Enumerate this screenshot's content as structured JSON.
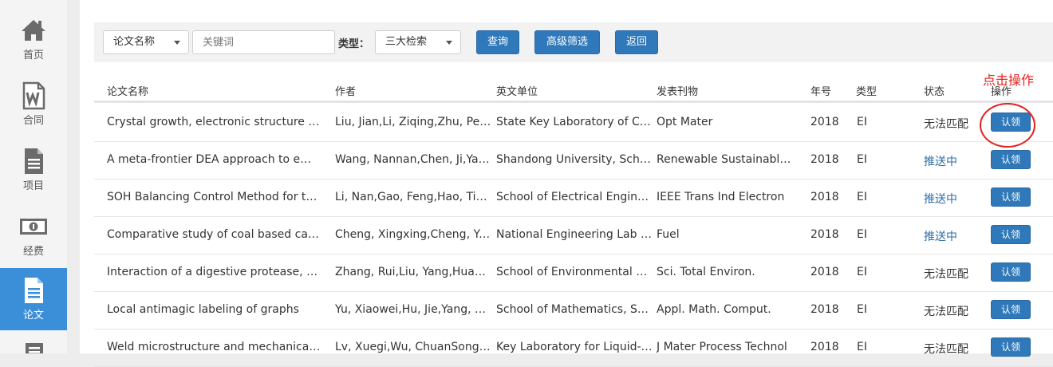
{
  "sidebar": {
    "items": [
      {
        "label": "首页",
        "icon": "home-icon",
        "active": false
      },
      {
        "label": "合同",
        "icon": "word-doc-icon",
        "active": false
      },
      {
        "label": "项目",
        "icon": "document-icon",
        "active": false
      },
      {
        "label": "经费",
        "icon": "money-icon",
        "active": false
      },
      {
        "label": "论文",
        "icon": "paper-icon",
        "active": true
      },
      {
        "label": "",
        "icon": "book-icon",
        "active": false
      }
    ],
    "active_color": "#3b8fd9"
  },
  "filter": {
    "field_select": "论文名称",
    "keyword_placeholder": "关键词",
    "type_label": "类型：",
    "type_select": "三大检索",
    "query_button": "查询",
    "advanced_button": "高级筛选",
    "back_button": "返回"
  },
  "table": {
    "headers": {
      "title": "论文名称",
      "author": "作者",
      "unit": "英文单位",
      "journal": "发表刊物",
      "year": "年号",
      "type": "类型",
      "status": "状态",
      "action": "操作"
    },
    "rows": [
      {
        "title": "Crystal growth, electronic structure an...",
        "author": "Liu, Jian,Li, Ziqing,Zhu, Pen...",
        "unit": "State Key Laboratory of Crys...",
        "journal": "Opt Mater",
        "year": "2018",
        "type": "EI",
        "status": "无法匹配",
        "status_kind": "nomatch",
        "action": "认领"
      },
      {
        "title": "A meta-frontier DEA approach to effici...",
        "author": "Wang, Nannan,Chen, Ji,Yao,...",
        "unit": "Shandong University, Schoo...",
        "journal": "Renewable Sustainable...",
        "year": "2018",
        "type": "EI",
        "status": "推送中",
        "status_kind": "push",
        "action": "认领"
      },
      {
        "title": "SOH Balancing Control Method for th...",
        "author": "Li, Nan,Gao, Feng,Hao, Tian...",
        "unit": "School of Electrical Enginee...",
        "journal": "IEEE Trans Ind Electron",
        "year": "2018",
        "type": "EI",
        "status": "推送中",
        "status_kind": "push",
        "action": "认领"
      },
      {
        "title": "Comparative study of coal based catal...",
        "author": "Cheng, Xingxing,Cheng, Yo...",
        "unit": "National Engineering Lab fo...",
        "journal": "Fuel",
        "year": "2018",
        "type": "EI",
        "status": "推送中",
        "status_kind": "push",
        "action": "认领"
      },
      {
        "title": "Interaction of a digestive protease, Ca...",
        "author": "Zhang, Rui,Liu, Yang,Huang,...",
        "unit": "School of Environmental Sci...",
        "journal": "Sci. Total Environ.",
        "year": "2018",
        "type": "EI",
        "status": "无法匹配",
        "status_kind": "nomatch",
        "action": "认领"
      },
      {
        "title": "Local antimagic labeling of graphs",
        "author": "Yu, Xiaowei,Hu, Jie,Yang, Do...",
        "unit": "School of Mathematics, Sha...",
        "journal": "Appl. Math. Comput.",
        "year": "2018",
        "type": "EI",
        "status": "无法匹配",
        "status_kind": "nomatch",
        "action": "认领"
      },
      {
        "title": "Weld microstructure and mechanical p...",
        "author": "Lv, Xuegi,Wu, ChuanSong,Y...",
        "unit": "Key Laboratory for Liquid-S...",
        "journal": "J Mater Process Technol",
        "year": "2018",
        "type": "EI",
        "status": "无法匹配",
        "status_kind": "nomatch",
        "action": "认领"
      }
    ]
  },
  "annotation": {
    "text": "点击操作",
    "color": "#e5201e"
  },
  "colors": {
    "primary": "#2f78b9",
    "push_status": "#2d6ea8"
  }
}
